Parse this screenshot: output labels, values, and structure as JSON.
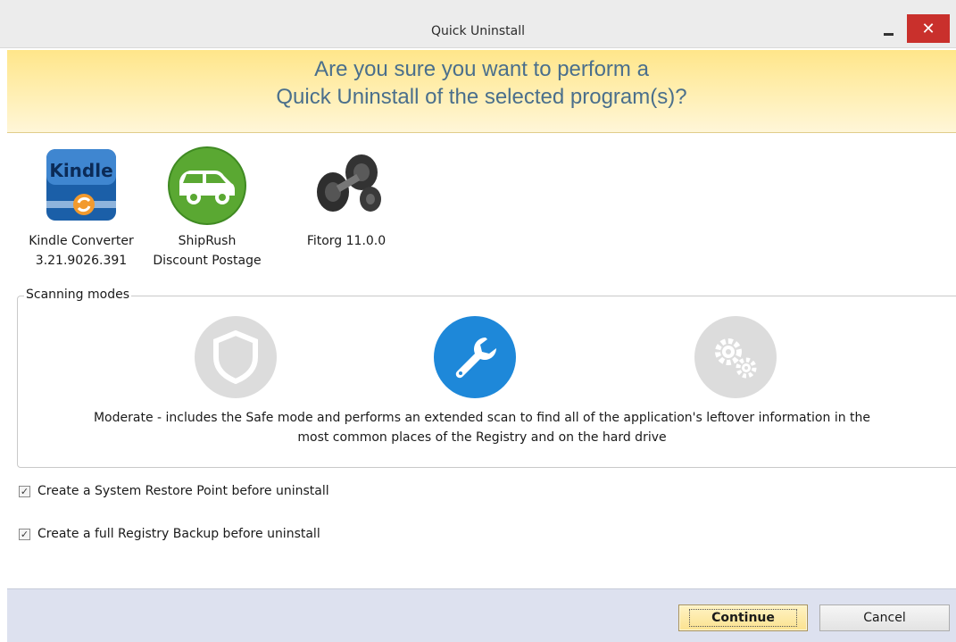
{
  "window": {
    "title": "Quick Uninstall",
    "minimize_icon": "minimize-icon",
    "close_icon": "close-icon",
    "close_glyph": "✕"
  },
  "banner": {
    "line1": "Are you sure you want to perform a",
    "line2": "Quick Uninstall of the selected program(s)?"
  },
  "programs": [
    {
      "name": "Kindle Converter",
      "version": "3.21.9026.391",
      "icon": "kindle-icon",
      "icon_text": "Kindle"
    },
    {
      "name": "ShipRush",
      "version": "Discount Postage",
      "icon": "car-icon"
    },
    {
      "name": "Fitorg 11.0.0",
      "version": "",
      "icon": "dumbbell-icon"
    }
  ],
  "scanning": {
    "label": "Scanning modes",
    "modes": [
      {
        "id": "safe",
        "icon": "shield-icon",
        "selected": false
      },
      {
        "id": "moderate",
        "icon": "wrench-icon",
        "selected": true
      },
      {
        "id": "advanced",
        "icon": "gears-icon",
        "selected": false
      }
    ],
    "description_line1": "Moderate - includes the Safe mode and performs an extended scan to find all of the application's leftover information in the",
    "description_line2": "most common places of the Registry and on the hard drive"
  },
  "options": [
    {
      "label": "Create a System Restore Point before uninstall",
      "checked": true,
      "check_glyph": "✓"
    },
    {
      "label": "Create a full Registry Backup before uninstall",
      "checked": true,
      "check_glyph": "✓"
    }
  ],
  "footer": {
    "continue_label": "Continue",
    "cancel_label": "Cancel"
  },
  "colors": {
    "banner_text": "#4a6f8c",
    "selected_mode": "#1e88d9",
    "close_button": "#c9302c"
  }
}
